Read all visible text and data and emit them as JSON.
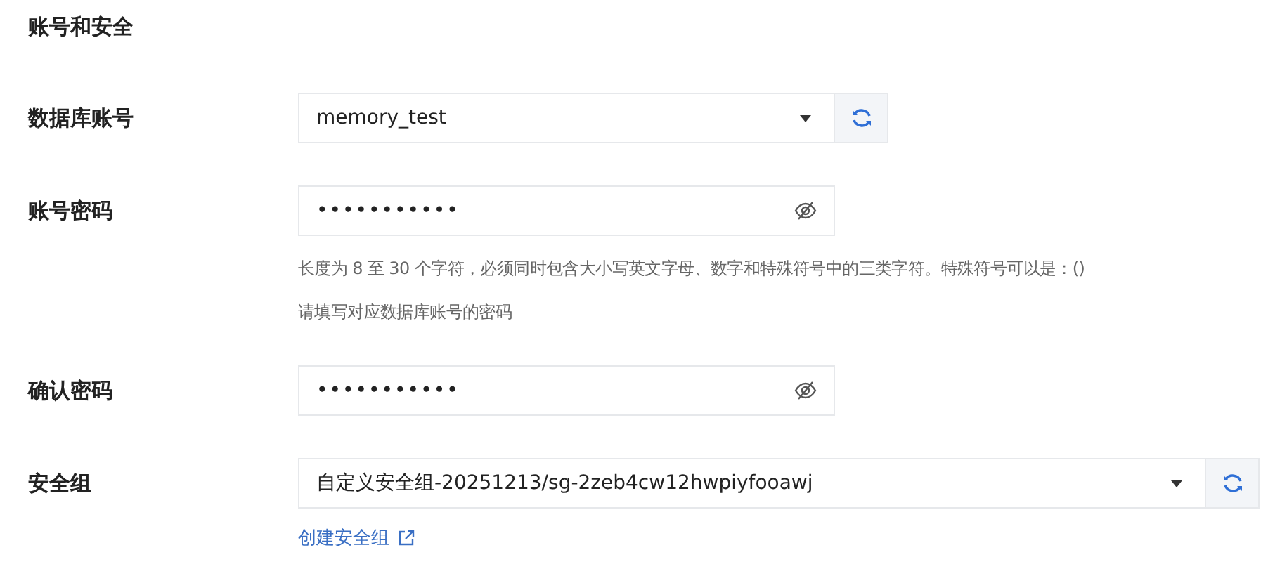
{
  "section_title": "账号和安全",
  "fields": [
    {
      "kind": "select",
      "label": "数据库账号",
      "value": "memory_test",
      "wide": false
    },
    {
      "kind": "password",
      "label": "账号密码",
      "value": "•••••••••••",
      "hints": [
        "长度为 8 至 30 个字符，必须同时包含大小写英文字母、数字和特殊符号中的三类字符。特殊符号可以是：()",
        "请填写对应数据库账号的密码"
      ]
    },
    {
      "kind": "password",
      "label": "确认密码",
      "value": "•••••••••••"
    },
    {
      "kind": "select",
      "label": "安全组",
      "value": "自定义安全组-20251213/sg-2zeb4cw12hwpiyfooawj",
      "wide": true,
      "link": "创建安全组"
    }
  ]
}
